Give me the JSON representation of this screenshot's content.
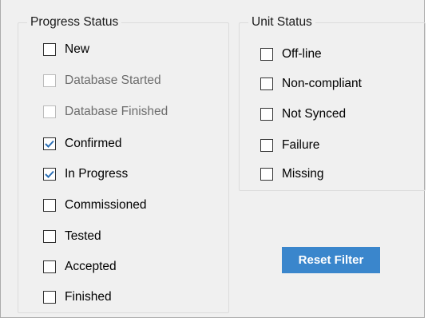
{
  "progress_status": {
    "title": "Progress Status",
    "items": [
      {
        "label": "New",
        "checked": false,
        "enabled": true
      },
      {
        "label": "Database Started",
        "checked": false,
        "enabled": false
      },
      {
        "label": "Database Finished",
        "checked": false,
        "enabled": false
      },
      {
        "label": "Confirmed",
        "checked": true,
        "enabled": true
      },
      {
        "label": "In Progress",
        "checked": true,
        "enabled": true
      },
      {
        "label": "Commissioned",
        "checked": false,
        "enabled": true
      },
      {
        "label": "Tested",
        "checked": false,
        "enabled": true
      },
      {
        "label": "Accepted",
        "checked": false,
        "enabled": true
      },
      {
        "label": "Finished",
        "checked": false,
        "enabled": true
      }
    ]
  },
  "unit_status": {
    "title": "Unit Status",
    "items": [
      {
        "label": "Off-line",
        "checked": false,
        "enabled": true
      },
      {
        "label": "Non-compliant",
        "checked": false,
        "enabled": true
      },
      {
        "label": "Not Synced",
        "checked": false,
        "enabled": true
      },
      {
        "label": "Failure",
        "checked": false,
        "enabled": true
      },
      {
        "label": "Missing",
        "checked": false,
        "enabled": true
      }
    ]
  },
  "reset_button": {
    "label": "Reset Filter"
  },
  "colors": {
    "accent": "#3a86cc",
    "checkmark": "#2b6fb5",
    "panel_bg": "#f0f0f0",
    "disabled_text": "#6d6d6d"
  },
  "icons": {
    "check": "checkmark-icon"
  }
}
